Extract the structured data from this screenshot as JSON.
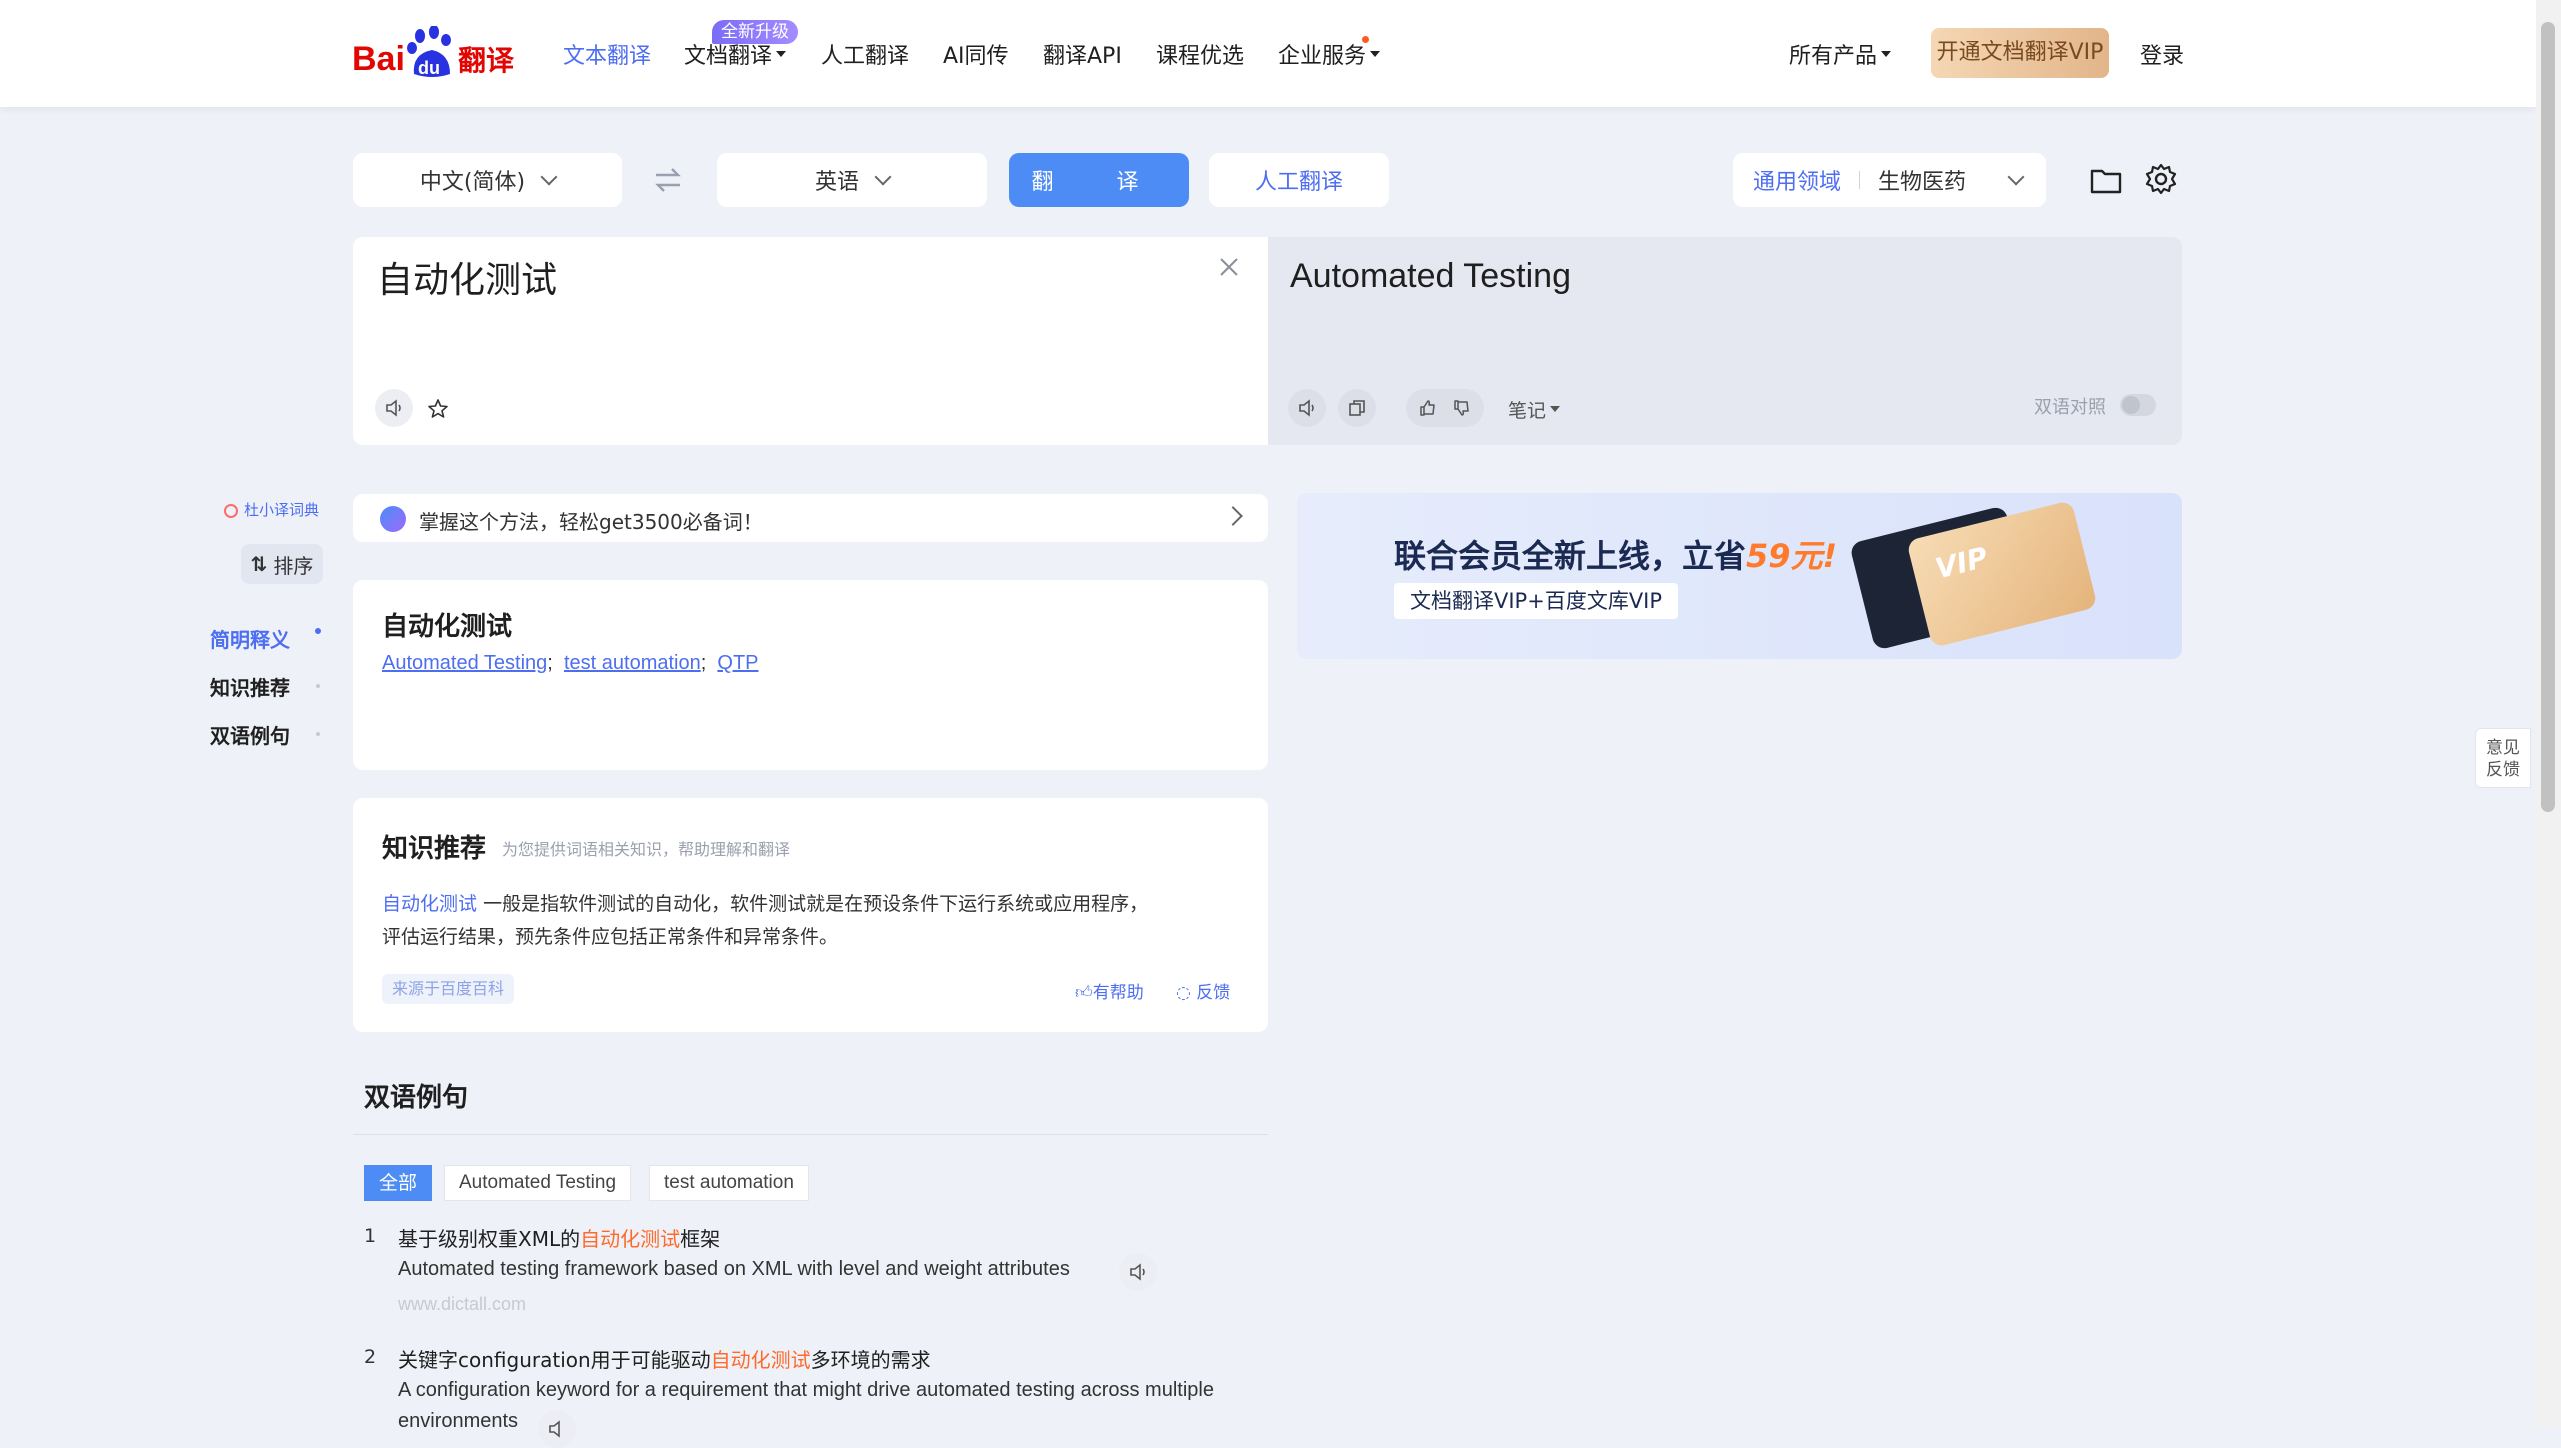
{
  "nav": {
    "logo_text": "Bai du 翻译",
    "items": [
      "文本翻译",
      "文档翻译",
      "人工翻译",
      "AI同传",
      "翻译API",
      "课程优选",
      "企业服务"
    ],
    "new_badge": "全新升级",
    "all_products": "所有产品",
    "vip_button": "开通文档翻译VIP",
    "login": "登录"
  },
  "controls": {
    "source_lang": "中文(简体)",
    "target_lang": "英语",
    "translate_button": "翻  译",
    "human_button": "人工翻译",
    "domain_general": "通用领域",
    "domain_selected": "生物医药"
  },
  "source": {
    "text": "自动化测试"
  },
  "target": {
    "text": "Automated Testing",
    "notes_label": "笔记",
    "bilingual_label": "双语对照"
  },
  "sidebar": {
    "dict_label": "杜小译词典",
    "sort_button": "排序",
    "items": [
      "简明释义",
      "知识推荐",
      "双语例句"
    ]
  },
  "tip_banner": {
    "text": "掌握这个方法，轻松get3500必备词！"
  },
  "brief": {
    "heading": "自动化测试",
    "meanings": [
      "Automated Testing",
      "test automation",
      "QTP"
    ]
  },
  "knowledge": {
    "heading": "知识推荐",
    "subheading": "为您提供词语相关知识，帮助理解和翻译",
    "term": "自动化测试",
    "body_line1": "一般是指软件测试的自动化，软件测试就是在预设条件下运行系统或应用程序，",
    "body_line2": "评估运行结果，预先条件应包括正常条件和异常条件。",
    "source_tag": "来源于百度百科",
    "helpful": "有帮助",
    "feedback": "反馈"
  },
  "ad": {
    "headline": "联合会员全新上线，立省",
    "price": "59元!",
    "sub": "文档翻译VIP+百度文库VIP",
    "card_text": "VIP"
  },
  "examples": {
    "heading": "双语例句",
    "tabs": [
      "全部",
      "Automated Testing",
      "test automation"
    ],
    "items": [
      {
        "num": "1",
        "cn_before": "基于级别权重XML的",
        "cn_hl": "自动化测试",
        "cn_after": "框架",
        "en": "Automated testing framework based on XML with level and weight attributes",
        "source": "www.dictall.com"
      },
      {
        "num": "2",
        "cn_before": "关键字configuration用于可能驱动",
        "cn_hl": "自动化测试",
        "cn_after": "多环境的需求",
        "en": "A configuration keyword for a requirement that might drive automated testing across multiple",
        "en2": "environments"
      }
    ]
  },
  "feedback_float": {
    "line1": "意见",
    "line2": "反馈"
  },
  "colors": {
    "accent": "#4e6ef2",
    "button": "#4e8cf5",
    "highlight": "#ff6a2b",
    "background": "#eef1f8"
  }
}
